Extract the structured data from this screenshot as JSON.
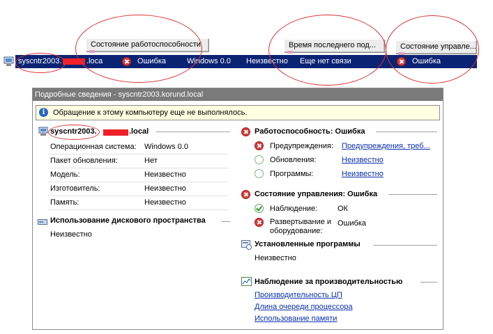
{
  "columns": {
    "health": "Состояние работоспособности",
    "last_contact": "Время последнего под...",
    "management": "Состояние управле..."
  },
  "row": {
    "name": "syscntr2003.",
    "name_suffix": ".loca",
    "health": "Ошибка",
    "os": "Windows 0.0",
    "service_pack": "Неизвестно",
    "last_contact": "Еще нет связи",
    "management": "Ошибка"
  },
  "details": {
    "title": "Подробные сведения - syscntr2003.korund.local",
    "info_message": "Обращение к этому компьютеру еще не выполнялось.",
    "computer": {
      "name_prefix": "syscntr2003.",
      "name_suffix": ".local",
      "props": [
        {
          "label": "Операционная система:",
          "value": "Windows 0.0"
        },
        {
          "label": "Пакет обновления:",
          "value": "Нет"
        },
        {
          "label": "Модель:",
          "value": "Неизвестно"
        },
        {
          "label": "Изготовитель:",
          "value": "Неизвестно"
        },
        {
          "label": "Память:",
          "value": "Неизвестно"
        }
      ]
    },
    "disk": {
      "title": "Использование дискового пространства",
      "value": "Неизвестно"
    },
    "health": {
      "title": "Работоспособность: Ошибка",
      "items": [
        {
          "label": "Предупреждения:",
          "value": "Предупреждения, треб...",
          "status": "error"
        },
        {
          "label": "Обновления:",
          "value": "Неизвестно",
          "status": "unknown"
        },
        {
          "label": "Программы:",
          "value": "Неизвестно",
          "status": "unknown"
        }
      ]
    },
    "management": {
      "title": "Состояние управления: Ошибка",
      "items": [
        {
          "label": "Наблюдение:",
          "value": "ОК",
          "status": "ok"
        },
        {
          "label_line1": "Развертывание и",
          "label_line2": "оборудование:",
          "value": "Ошибка",
          "status": "error"
        }
      ]
    },
    "installed": {
      "title": "Установленные программы",
      "value": "Неизвестно"
    },
    "perf": {
      "title": "Наблюдение за производительностью",
      "links": [
        "Производительность ЦП",
        "Длина очереди процессора",
        "Использование памяти"
      ]
    }
  },
  "colors": {
    "selection": "#0b2373",
    "link": "#0a2fb0",
    "annotation": "#dd3333",
    "redaction": "#f0202a"
  }
}
